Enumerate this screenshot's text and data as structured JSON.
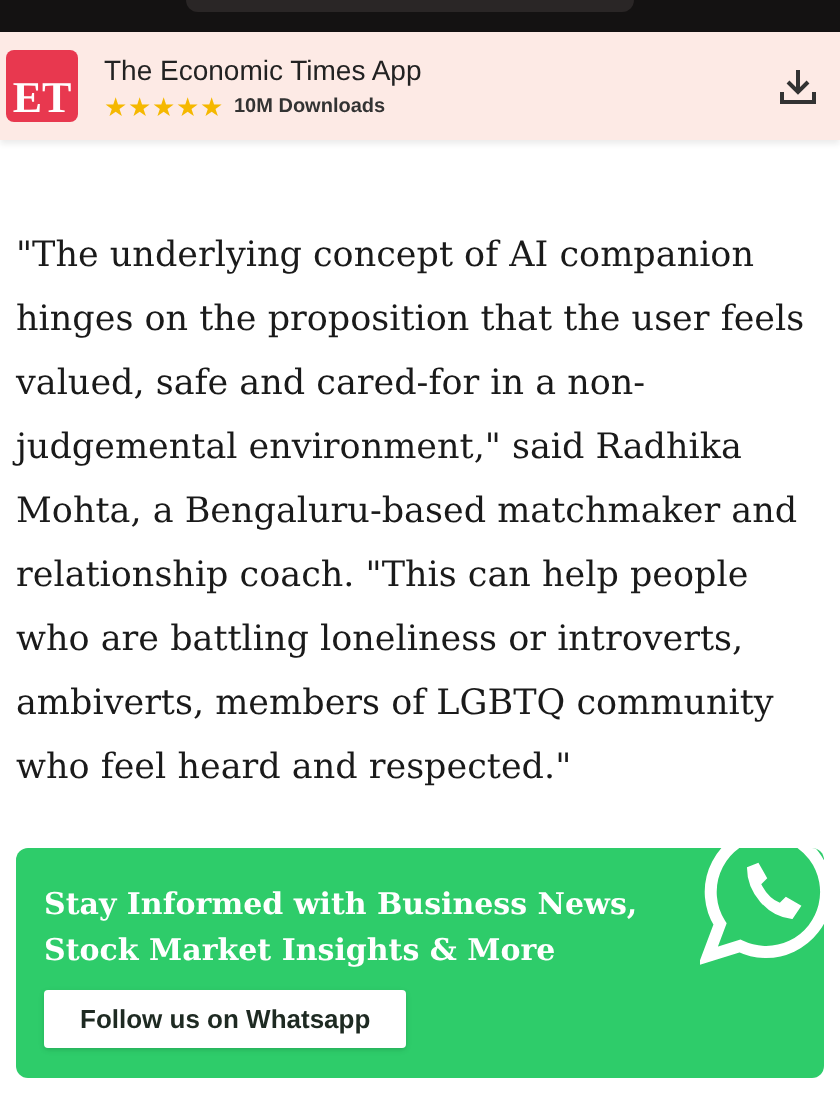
{
  "app_banner": {
    "logo": "ET",
    "title": "The Economic Times App",
    "stars": 5,
    "downloads": "10M Downloads"
  },
  "article": {
    "paragraph": "\"The underlying concept of AI companion hinges on the proposition that the user feels valued, safe and cared-for in a non-judgemental environment,\" said Radhika Mohta, a Bengaluru-based matchmaker and relationship coach. \"This can help people who are battling loneliness or introverts, ambiverts, members of LGBTQ community who feel heard and respected.\""
  },
  "whatsapp_card": {
    "headline": "Stay Informed with Business News, Stock Market Insights & More",
    "button": "Follow us on Whatsapp"
  }
}
